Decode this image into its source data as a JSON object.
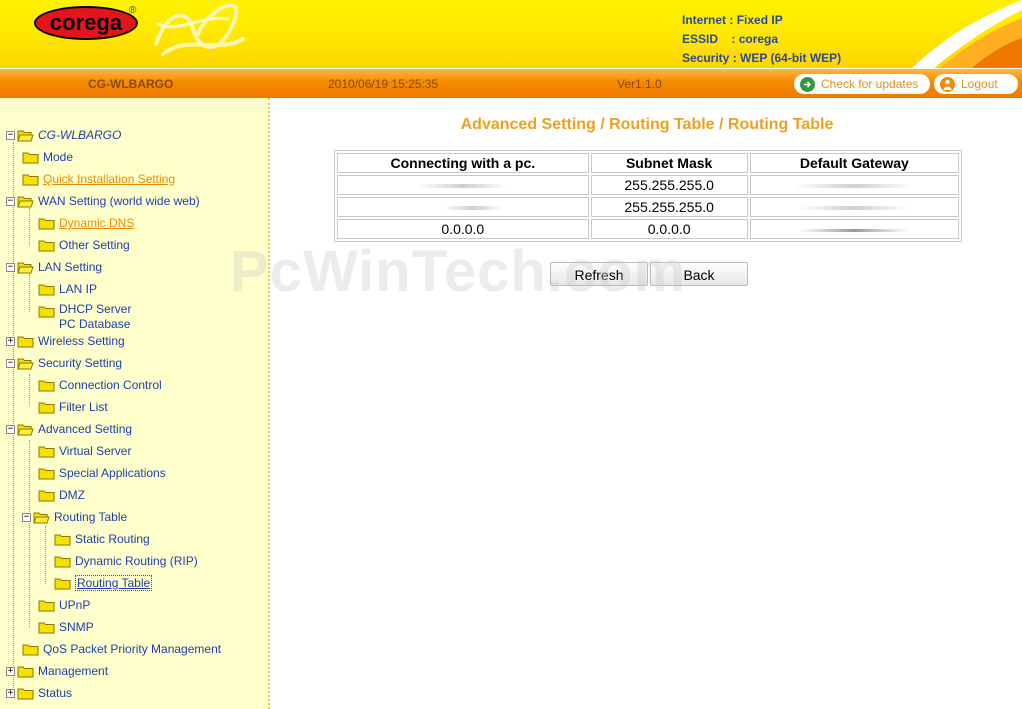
{
  "header": {
    "logo_text": "corega",
    "logo_reg": "®",
    "info": [
      {
        "key": "Internet",
        "sep": " : ",
        "value": "Fixed IP"
      },
      {
        "key": "ESSID",
        "sep": "    : ",
        "value": "corega"
      },
      {
        "key": "Security",
        "sep": " : ",
        "value": "WEP (64-bit WEP)"
      }
    ]
  },
  "bar": {
    "model": "CG-WLBARGO",
    "datetime": "2010/06/19 15:25:35",
    "version": "Ver1.1.0",
    "check_updates": "Check for updates",
    "logout": "Logout"
  },
  "sidebar": {
    "items": [
      {
        "label": "CG-WLBARGO"
      },
      {
        "label": "Mode"
      },
      {
        "label": "Quick Installation Setting"
      },
      {
        "label": "WAN Setting (world wide web)"
      },
      {
        "label": "Dynamic DNS"
      },
      {
        "label": "Other Setting"
      },
      {
        "label": "LAN Setting"
      },
      {
        "label": "LAN IP"
      },
      {
        "label": "DHCP Server"
      },
      {
        "label": "PC Database"
      },
      {
        "label": "Wireless Setting"
      },
      {
        "label": "Security Setting"
      },
      {
        "label": "Connection Control"
      },
      {
        "label": "Filter List"
      },
      {
        "label": "Advanced Setting"
      },
      {
        "label": "Virtual Server"
      },
      {
        "label": "Special Applications"
      },
      {
        "label": "DMZ"
      },
      {
        "label": "Routing Table"
      },
      {
        "label": "Static Routing"
      },
      {
        "label": "Dynamic Routing (RIP)"
      },
      {
        "label": "Routing Table"
      },
      {
        "label": "UPnP"
      },
      {
        "label": "SNMP"
      },
      {
        "label": "QoS Packet Priority Management"
      },
      {
        "label": "Management"
      },
      {
        "label": "Status"
      }
    ]
  },
  "main": {
    "title": "Advanced Setting / Routing Table / Routing Table",
    "table": {
      "headers": [
        "Connecting with a pc.",
        "Subnet Mask",
        "Default Gateway"
      ],
      "rows": [
        [
          "",
          "255.255.255.0",
          ""
        ],
        [
          "",
          "255.255.255.0",
          ""
        ],
        [
          "0.0.0.0",
          "0.0.0.0",
          ""
        ]
      ]
    },
    "refresh_label": "Refresh",
    "back_label": "Back"
  },
  "watermark": "PcWinTech.com",
  "colors": {
    "header_yellow": "#ffe600",
    "bar_orange": "#f58a00",
    "sidebar_bg": "#ffffcc",
    "link_blue": "#1f3fae",
    "title_orange": "#f0a020"
  }
}
